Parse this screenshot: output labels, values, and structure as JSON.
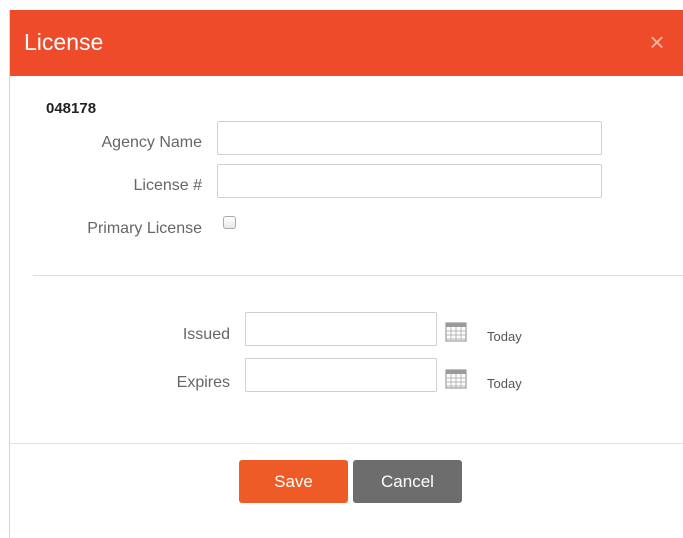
{
  "dialog": {
    "title": "License",
    "close_symbol": "×",
    "license_code": "048178"
  },
  "form": {
    "agency_name_label": "Agency Name",
    "agency_name_value": "",
    "license_number_label": "License #",
    "license_number_value": "",
    "primary_license_label": "Primary License",
    "primary_license_checked": false,
    "issued_label": "Issued",
    "issued_value": "",
    "issued_today": "Today",
    "expires_label": "Expires",
    "expires_value": "",
    "expires_today": "Today"
  },
  "buttons": {
    "save_label": "Save",
    "cancel_label": "Cancel"
  },
  "colors": {
    "header": "#ee4b2b",
    "save": "#ef5b27",
    "cancel": "#6d6d6d"
  },
  "icons": {
    "close": "close-icon",
    "calendar": "calendar-icon"
  }
}
